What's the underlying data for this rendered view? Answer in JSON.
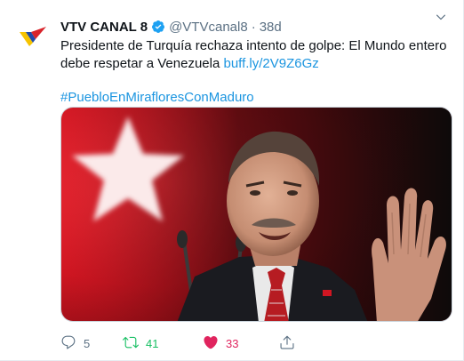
{
  "tweet": {
    "display_name": "VTV CANAL 8",
    "handle": "@VTVcanal8",
    "separator": "·",
    "time": "38d",
    "text": "Presidente de Turquía rechaza intento de golpe: El Mundo entero debe respetar a Venezuela ",
    "link": "buff.ly/2V9Z6Gz",
    "hashtag": "#PuebloEnMirafloresConMaduro",
    "counts": {
      "replies": "5",
      "retweets": "41",
      "likes": "33"
    },
    "states": {
      "retweeted": true,
      "liked": true
    }
  },
  "colors": {
    "link": "#1b95e0",
    "retweet_active": "#17bf63",
    "like_active": "#e0245e",
    "secondary_text": "#5b7083",
    "verified": "#1da1f2",
    "flag_red": "#e30a17"
  },
  "icons": {
    "avatar": "vtv-logo-icon",
    "verified": "verified-badge-icon",
    "menu": "chevron-down-icon",
    "reply": "reply-icon",
    "retweet": "retweet-icon",
    "like": "heart-icon",
    "share": "share-icon"
  }
}
